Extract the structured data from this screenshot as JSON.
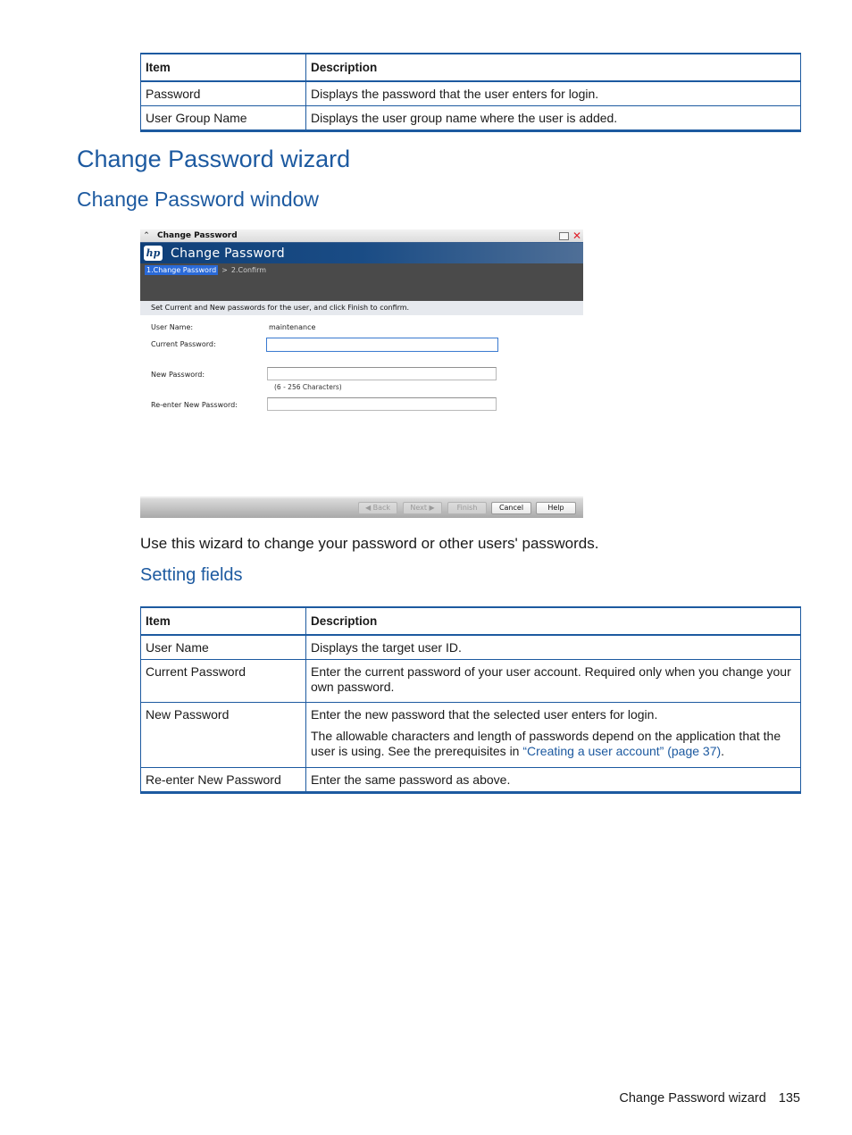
{
  "table1": {
    "headers": [
      "Item",
      "Description"
    ],
    "rows": [
      {
        "item": "Password",
        "description": "Displays the password that the user enters for login."
      },
      {
        "item": "User Group Name",
        "description": "Displays the user group name where the user is added."
      }
    ]
  },
  "section_title": "Change Password wizard",
  "subsection_title": "Change Password window",
  "window": {
    "title_bar": "Change Password",
    "header_title": "Change Password",
    "logo_text": "hp",
    "steps": {
      "active": "1.Change Password",
      "separator": ">",
      "next": "2.Confirm"
    },
    "instruction": "Set Current and New passwords for the user, and click Finish to confirm.",
    "fields": {
      "user_name_label": "User Name:",
      "user_name_value": "maintenance",
      "current_password_label": "Current Password:",
      "current_password_value": "",
      "new_password_label": "New Password:",
      "new_password_value": "",
      "new_password_hint": "(6 - 256 Characters)",
      "reenter_label": "Re-enter New Password:",
      "reenter_value": ""
    },
    "buttons": {
      "back": "◀ Back",
      "next": "Next ▶",
      "finish": "Finish",
      "cancel": "Cancel",
      "help": "Help"
    },
    "close_color": "#e0202a",
    "header_color": "#0f3f78",
    "step_active_color": "#2a6ad8"
  },
  "intro_text": "Use this wizard to change your password or other users' passwords.",
  "setting_fields_title": "Setting fields",
  "table2": {
    "headers": [
      "Item",
      "Description"
    ],
    "rows": [
      {
        "item": "User Name",
        "description": "Displays the target user ID."
      },
      {
        "item": "Current Password",
        "description": "Enter the current password of your user account. Required only when you change your own password."
      },
      {
        "item": "New Password",
        "description": "Enter the new password that the selected user enters for login.",
        "description2_prefix": "The allowable characters and length of passwords depend on the application that the user is using. See the prerequisites in ",
        "description2_link": "“Creating a user account” (page 37)",
        "description2_suffix": "."
      },
      {
        "item": "Re-enter New Password",
        "description": "Enter the same password as above."
      }
    ]
  },
  "footer": {
    "section": "Change Password wizard",
    "page": "135"
  },
  "colors": {
    "heading": "#1d5aa0",
    "table_border": "#1d5aa0",
    "link": "#1d5aa0"
  }
}
